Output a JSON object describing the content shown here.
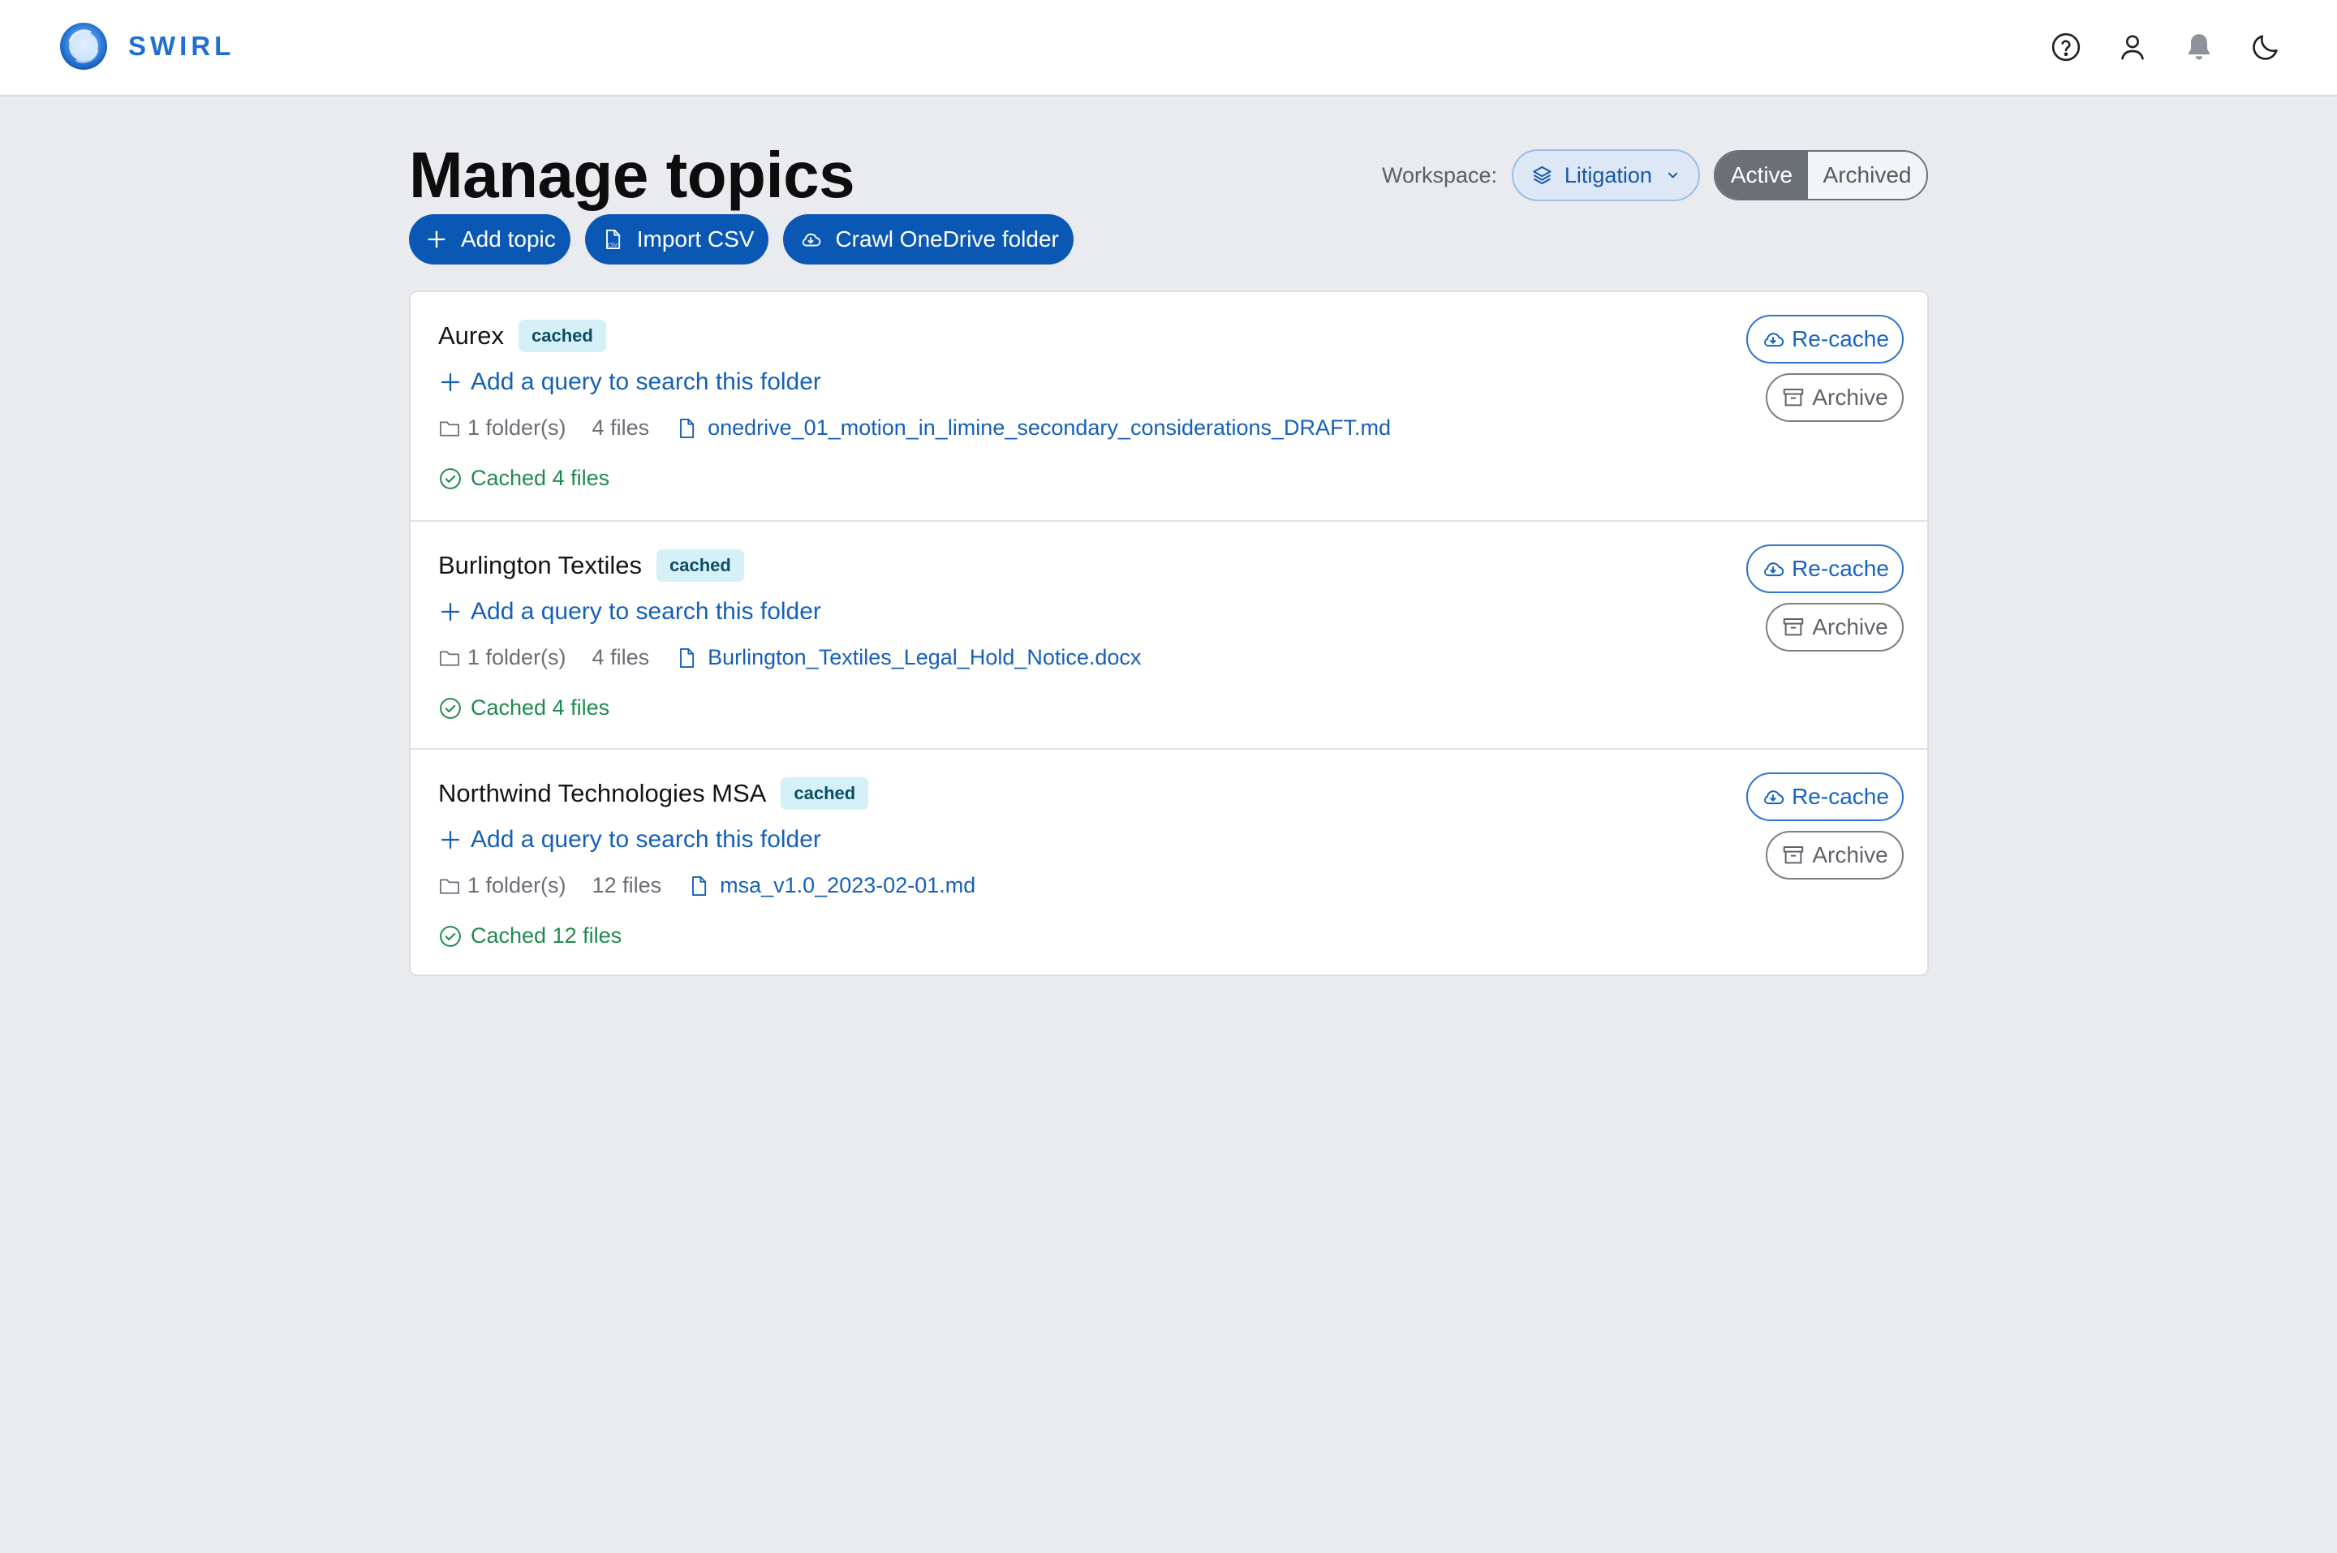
{
  "app": {
    "brand": "SWIRL"
  },
  "header": {
    "title": "Manage topics",
    "workspace_label": "Workspace:",
    "workspace_value": "Litigation",
    "filter": {
      "active": "Active",
      "archived": "Archived",
      "selected": "Active"
    }
  },
  "actions": {
    "add_topic": "Add topic",
    "import_csv": "Import CSV",
    "crawl_onedrive": "Crawl OneDrive folder"
  },
  "topics": [
    {
      "name": "Aurex",
      "badge": "cached",
      "add_query": "Add a query to search this folder",
      "folders": "1 folder(s)",
      "files": "4 files",
      "file_name": "onedrive_01_motion_in_limine_secondary_considerations_DRAFT.md",
      "cache_status": "Cached 4 files",
      "recache_label": "Re-cache",
      "archive_label": "Archive"
    },
    {
      "name": "Burlington Textiles",
      "badge": "cached",
      "add_query": "Add a query to search this folder",
      "folders": "1 folder(s)",
      "files": "4 files",
      "file_name": "Burlington_Textiles_Legal_Hold_Notice.docx",
      "cache_status": "Cached 4 files",
      "recache_label": "Re-cache",
      "archive_label": "Archive"
    },
    {
      "name": "Northwind Technologies MSA",
      "badge": "cached",
      "add_query": "Add a query to search this folder",
      "folders": "1 folder(s)",
      "files": "12 files",
      "file_name": "msa_v1.0_2023-02-01.md",
      "cache_status": "Cached 12 files",
      "recache_label": "Re-cache",
      "archive_label": "Archive"
    }
  ],
  "colors": {
    "primary": "#0a58b4",
    "brand": "#1f6fd0",
    "success": "#1f8a4f",
    "badge_bg": "#d5f1f7",
    "page_bg": "#eaebef"
  },
  "icons": {
    "top": [
      "help-icon",
      "user-icon",
      "bell-icon",
      "moon-icon"
    ],
    "workspace": "layers-icon",
    "actions": [
      "plus-icon",
      "csv-file-icon",
      "cloud-download-icon"
    ],
    "topic": [
      "plus-icon",
      "folder-icon",
      "file-icon",
      "check-circle-icon",
      "cloud-download-icon",
      "archive-box-icon"
    ]
  }
}
